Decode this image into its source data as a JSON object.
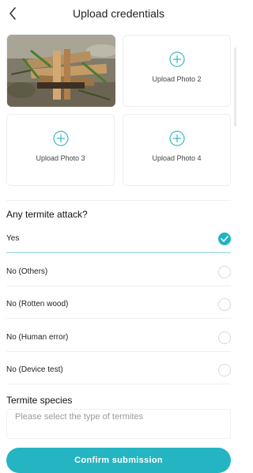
{
  "header": {
    "title": "Upload credentials",
    "back_icon": "chevron-left-icon"
  },
  "photos": {
    "uploaded_photo_alt": "",
    "slots": [
      {
        "label": "Upload Photo 2",
        "icon": "plus-circle-icon"
      },
      {
        "label": "Upload Photo 3",
        "icon": "plus-circle-icon"
      },
      {
        "label": "Upload Photo 4",
        "icon": "plus-circle-icon"
      }
    ]
  },
  "termite_attack": {
    "question": "Any termite attack?",
    "options": [
      {
        "label": "Yes",
        "selected": true
      },
      {
        "label": "No (Others)",
        "selected": false
      },
      {
        "label": "No (Rotten wood)",
        "selected": false
      },
      {
        "label": "No (Human error)",
        "selected": false
      },
      {
        "label": "No (Device test)",
        "selected": false
      }
    ]
  },
  "species": {
    "title": "Termite species",
    "placeholder": "Please select the type of termites"
  },
  "submit": {
    "label": "Confirm submission"
  },
  "colors": {
    "accent": "#25b5c2",
    "divider": "#f0f0f0"
  }
}
